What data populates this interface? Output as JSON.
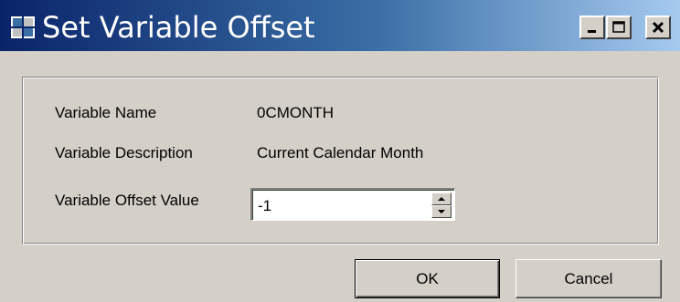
{
  "window": {
    "title": "Set Variable Offset",
    "app_icon": "grid-app-icon",
    "caption_buttons": [
      "minimize-icon",
      "maximize-icon",
      "close-icon"
    ]
  },
  "fields": {
    "name_label": "Variable Name",
    "name_value": "0CMONTH",
    "description_label": "Variable Description",
    "description_value": "Current Calendar Month",
    "offset_label": "Variable Offset Value",
    "offset_value": "-1"
  },
  "buttons": {
    "ok_label": "OK",
    "cancel_label": "Cancel"
  },
  "colors": {
    "titlebar_start": "#0a246a",
    "titlebar_end": "#a6caf0",
    "face": "#d4d0c8"
  }
}
